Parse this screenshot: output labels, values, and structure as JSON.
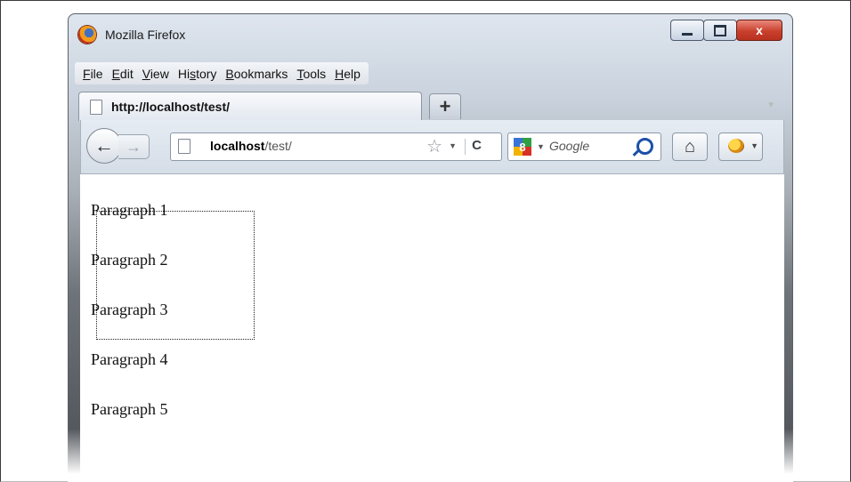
{
  "window": {
    "title": "Mozilla Firefox"
  },
  "window_controls": {
    "minimize": "",
    "maximize": "",
    "close": "x"
  },
  "menu": [
    "File",
    "Edit",
    "View",
    "History",
    "Bookmarks",
    "Tools",
    "Help"
  ],
  "tab": {
    "title": "http://localhost/test/",
    "new_tab_label": "+"
  },
  "address_bar": {
    "host": "localhost",
    "path": "/test/"
  },
  "search_bar": {
    "engine_label": "Google"
  },
  "content": {
    "paragraphs": [
      "Paragraph 1",
      "Paragraph 2",
      "Paragraph 3",
      "Paragraph 4",
      "Paragraph 5"
    ]
  }
}
